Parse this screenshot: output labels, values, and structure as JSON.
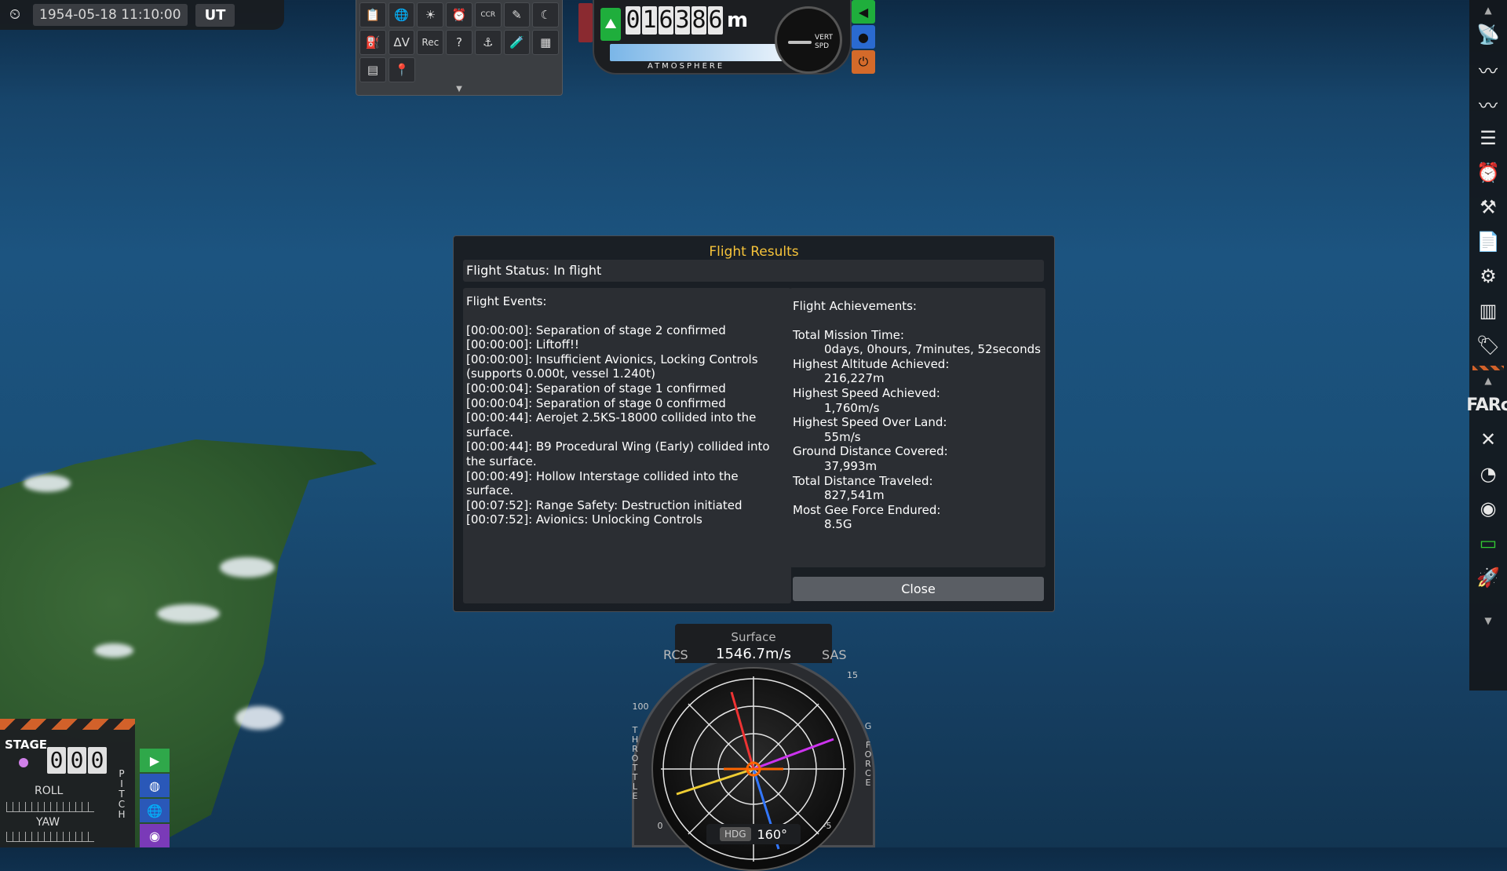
{
  "clock": {
    "date": "1954-05-18 11:10:00",
    "mode": "UT"
  },
  "toolbar": {
    "row1": [
      "📋",
      "🌐",
      "☀",
      "⏰",
      "CCR",
      "✎",
      "☾"
    ],
    "row2": [
      "⛽",
      "ΔV",
      "Rec",
      "?",
      "⚓",
      "🧪",
      "▦"
    ],
    "row3": [
      "▤",
      "📍"
    ]
  },
  "altimeter": {
    "digits": [
      "0",
      "1",
      "6",
      "3",
      "8",
      "6"
    ],
    "unit": "m",
    "label": "ATMOSPHERE",
    "vspd_label_1": "VERT",
    "vspd_label_2": "SPD"
  },
  "dialog": {
    "title": "Flight Results",
    "status": "Flight Status: In flight",
    "events_header": "Flight Events:",
    "events": [
      "[00:00:00]: Separation of stage 2 confirmed",
      "[00:00:00]: Liftoff!!",
      "[00:00:00]: Insufficient Avionics, Locking Controls (supports 0.000t, vessel 1.240t)",
      "[00:00:04]: Separation of stage 1 confirmed",
      "[00:00:04]: Separation of stage 0 confirmed",
      "[00:00:44]: Aerojet 2.5KS-18000 collided into the surface.",
      "[00:00:44]: B9 Procedural Wing (Early) collided into the surface.",
      "[00:00:49]: Hollow Interstage collided into the surface.",
      "[00:07:52]: Range Safety: Destruction initiated",
      "[00:07:52]: Avionics: Unlocking Controls"
    ],
    "achievements_header": "Flight Achievements:",
    "achievements": [
      {
        "label": "Total Mission Time:",
        "value": "0days, 0hours, 7minutes, 52seconds"
      },
      {
        "label": "Highest Altitude Achieved:",
        "value": "216,227m"
      },
      {
        "label": "Highest Speed Achieved:",
        "value": "1,760m/s"
      },
      {
        "label": "Highest Speed Over Land:",
        "value": "55m/s"
      },
      {
        "label": "Ground Distance Covered:",
        "value": "37,993m"
      },
      {
        "label": "Total Distance Traveled:",
        "value": "827,541m"
      },
      {
        "label": "Most Gee Force Endured:",
        "value": "8.5G"
      }
    ],
    "close_label": "Close"
  },
  "navball": {
    "mode": "Surface",
    "speed": "1546.7m/s",
    "rcs": "RCS",
    "sas": "SAS",
    "hdg_label": "HDG",
    "heading": "160°",
    "throttle_label": "THROTTLE",
    "gforce_label": "G FORCE",
    "throttle_max": "100",
    "throttle_min": "0",
    "g_max": "15",
    "g_min": "-5"
  },
  "stage": {
    "label": "STAGE",
    "digits": [
      "0",
      "0",
      "0"
    ],
    "roll": "ROLL",
    "yaw": "YAW",
    "pitch": "PITCH"
  },
  "right_bar": {
    "farc_label": "FARc"
  }
}
